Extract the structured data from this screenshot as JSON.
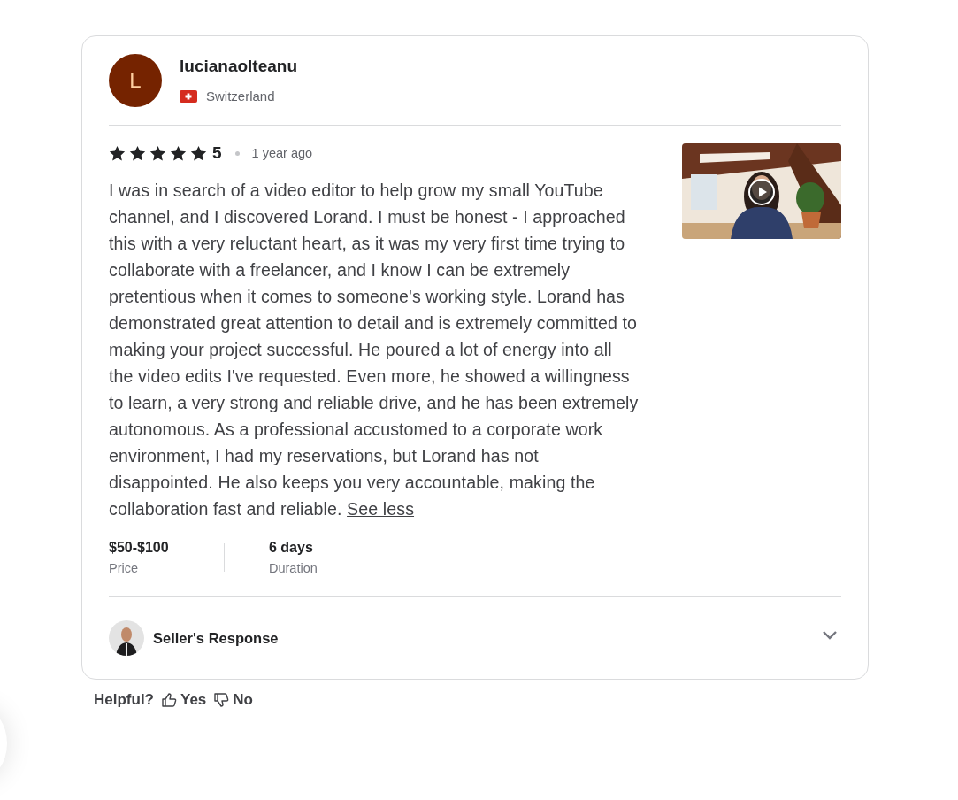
{
  "reviewer": {
    "initial": "L",
    "name": "lucianaolteanu",
    "country": "Switzerland"
  },
  "review": {
    "stars": 5,
    "rating": "5",
    "time": "1 year ago",
    "text": "I was in search of a video editor to help grow my small YouTube channel, and I discovered Lorand. I must be honest - I approached this with a very reluctant heart, as it was my very first time trying to collaborate with a freelancer, and I know I can be extremely pretentious when it comes to someone's working style. Lorand has demonstrated great attention to detail and is extremely committed to making your project successful. He poured a lot of energy into all the video edits I've requested. Even more, he showed a willingness to learn, a very strong and reliable drive, and he has been extremely autonomous. As a professional accustomed to a corporate work environment, I had my reservations, but Lorand has not disappointed. He also keeps you very accountable, making the collaboration fast and reliable.",
    "toggle": "See less"
  },
  "details": [
    {
      "value": "$50-$100",
      "label": "Price"
    },
    {
      "value": "6 days",
      "label": "Duration"
    }
  ],
  "seller_response": {
    "title": "Seller's Response",
    "expanded": false
  },
  "helpful": {
    "label": "Helpful?",
    "yes": "Yes",
    "no": "No"
  }
}
